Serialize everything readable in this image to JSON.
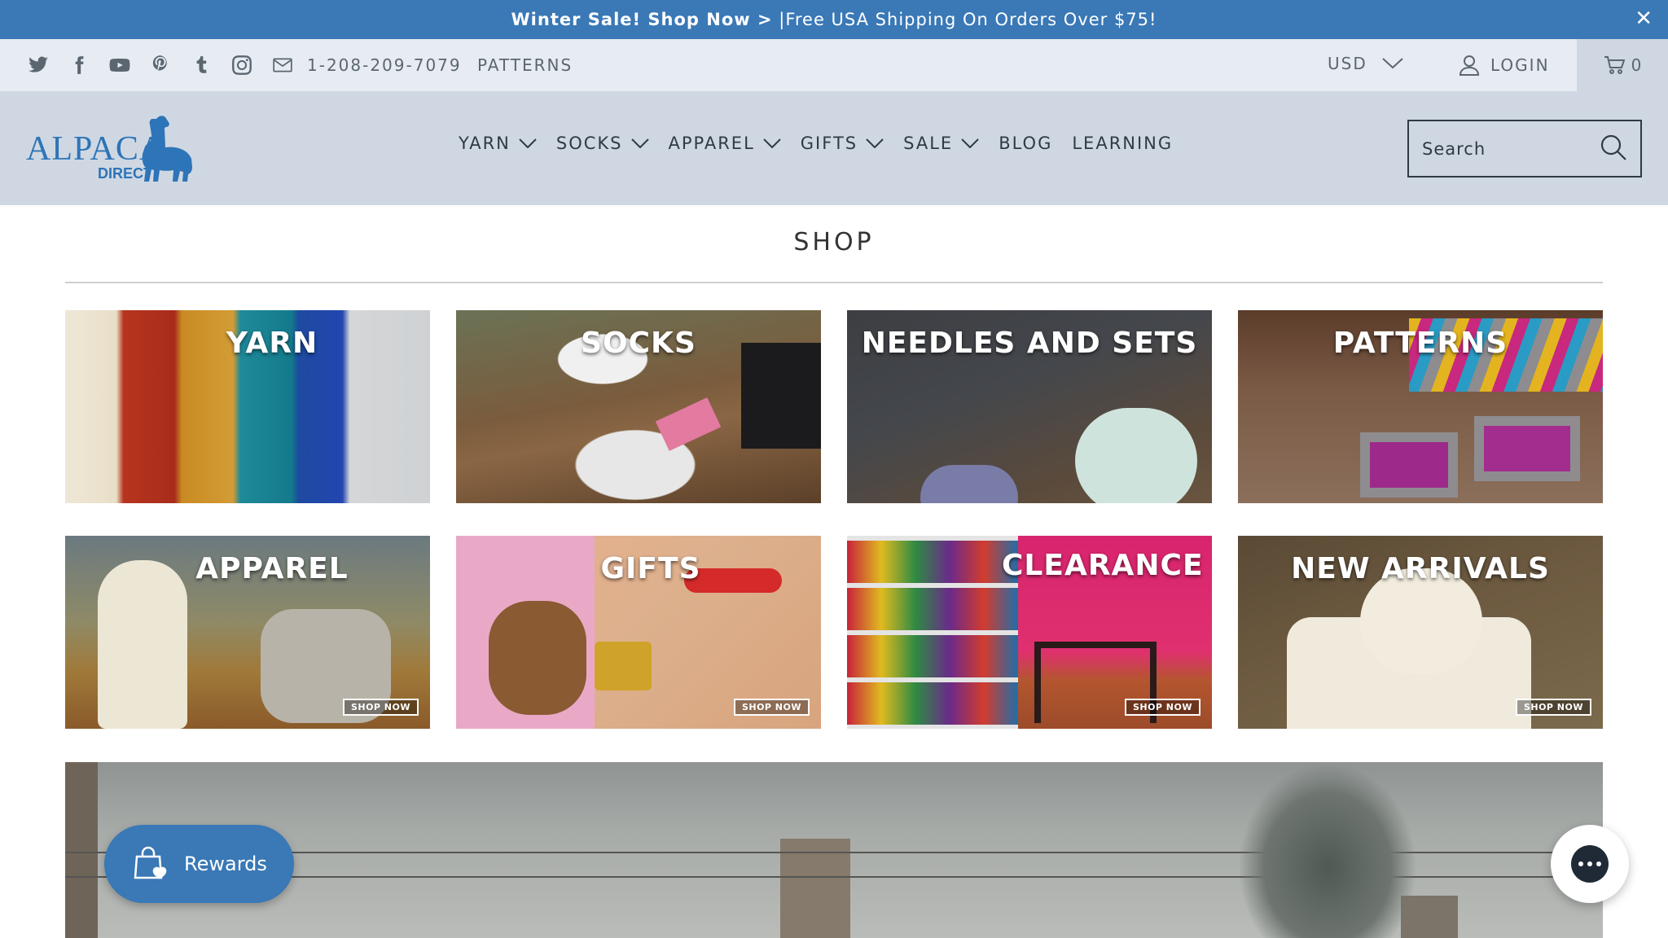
{
  "announcement": {
    "bold": "Winter Sale! Shop Now >",
    "rest": " |Free USA Shipping On Orders Over $75!",
    "close": "✕"
  },
  "topbar": {
    "social_icons": [
      "twitter-icon",
      "facebook-icon",
      "youtube-icon",
      "pinterest-icon",
      "tumblr-icon",
      "instagram-icon",
      "email-icon"
    ],
    "phone": "1-208-209-7079",
    "patterns": "PATTERNS",
    "currency": "USD",
    "login": "LOGIN",
    "cart_count": "0"
  },
  "header": {
    "logo_text": "ALPACA",
    "logo_sub": "DIRECT",
    "nav": [
      {
        "label": "YARN",
        "dropdown": true
      },
      {
        "label": "SOCKS",
        "dropdown": true
      },
      {
        "label": "APPAREL",
        "dropdown": true
      },
      {
        "label": "GIFTS",
        "dropdown": true
      },
      {
        "label": "SALE",
        "dropdown": true
      },
      {
        "label": "BLOG",
        "dropdown": false
      },
      {
        "label": "LEARNING",
        "dropdown": false
      }
    ],
    "search_placeholder": "Search"
  },
  "shop": {
    "title": "SHOP",
    "tiles": [
      {
        "label": "YARN",
        "shop_now": ""
      },
      {
        "label": "SOCKS",
        "shop_now": ""
      },
      {
        "label": "NEEDLES AND SETS",
        "shop_now": ""
      },
      {
        "label": "PATTERNS",
        "shop_now": ""
      },
      {
        "label": "APPAREL",
        "shop_now": "SHOP NOW"
      },
      {
        "label": "GIFTS",
        "shop_now": "SHOP NOW"
      },
      {
        "label": "CLEARANCE",
        "shop_now": "SHOP NOW"
      },
      {
        "label": "NEW ARRIVALS",
        "shop_now": "SHOP NOW"
      }
    ]
  },
  "widgets": {
    "rewards": "Rewards"
  },
  "colors": {
    "brand_blue": "#3a78b6",
    "header_bg": "#cfd8e2",
    "topbar_bg": "#e6ecf2"
  }
}
